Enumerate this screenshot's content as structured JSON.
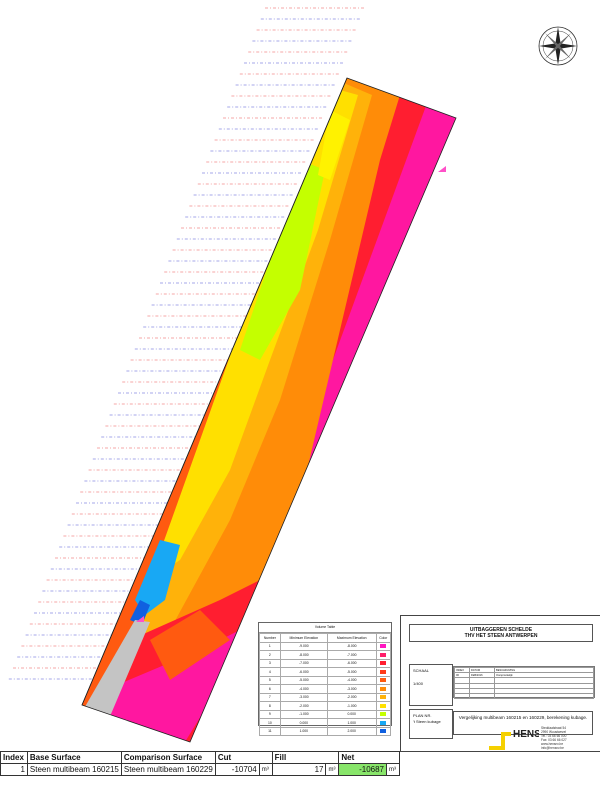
{
  "map": {
    "colors": {
      "magenta": "#ff17a0",
      "red": "#ff1e30",
      "orange_red": "#ff5a10",
      "orange": "#ff8c08",
      "amber": "#ffb20a",
      "yellow": "#fff200",
      "yellow_green": "#c4ff00",
      "cyan": "#18a8f4",
      "gray": "#c4c4c4",
      "label_red": "#f06060",
      "label_blue": "#5a60d8"
    }
  },
  "volume_table": {
    "title": "Volume Table",
    "headers": [
      "Number",
      "Minimum Elevation",
      "Maximum Elevation",
      "Color"
    ],
    "rows": [
      {
        "n": "1",
        "min": "-9.000",
        "max": "-8.000",
        "color": "#ff17c0"
      },
      {
        "n": "2",
        "min": "-8.000",
        "max": "-7.000",
        "color": "#ff1e6a"
      },
      {
        "n": "3",
        "min": "-7.000",
        "max": "-6.000",
        "color": "#ff1e30"
      },
      {
        "n": "4",
        "min": "-6.000",
        "max": "-5.000",
        "color": "#ff3a18"
      },
      {
        "n": "5",
        "min": "-5.000",
        "max": "-4.000",
        "color": "#ff5a10"
      },
      {
        "n": "6",
        "min": "-4.000",
        "max": "-3.000",
        "color": "#ff8c08"
      },
      {
        "n": "7",
        "min": "-3.000",
        "max": "-2.000",
        "color": "#ffb20a"
      },
      {
        "n": "8",
        "min": "-2.000",
        "max": "-1.000",
        "color": "#ffe000"
      },
      {
        "n": "9",
        "min": "-1.000",
        "max": "0.000",
        "color": "#c4ff00"
      },
      {
        "n": "10",
        "min": "0.000",
        "max": "1.000",
        "color": "#18a8f4"
      },
      {
        "n": "11",
        "min": "1.000",
        "max": "2.000",
        "color": "#1060e0"
      }
    ]
  },
  "title_block": {
    "title_line1": "UITBAGGEREN SCHELDE",
    "title_line2": "THV HET STEEN ANTWERPEN",
    "scale_label": "SCHAAL",
    "scale_value": "1/400",
    "rev_headers": [
      "INDEX",
      "DATUM",
      "BESCHRIJVING"
    ],
    "rev_row": [
      "00",
      "FEB/2016",
      "Oorspronkelijk"
    ],
    "plan_label": "PLAN NR.",
    "plan_value": "'t Steen kubage",
    "description": "Vergelijking multibeam 160215 en 160229, berekening kubage."
  },
  "company": {
    "name": "HENS",
    "address": [
      "Steddaalstraat 54",
      "2990 Wuustwezel",
      "Tel.: 03 66 66 000",
      "Fax: 03 66 66 027",
      "www.hensnv.be",
      "info@hensnv.be"
    ]
  },
  "results": {
    "headers": {
      "index": "Index",
      "base": "Base Surface",
      "comparison": "Comparison Surface",
      "cut": "Cut",
      "fill": "Fill",
      "net": "Net"
    },
    "row": {
      "index": "1",
      "base": "Steen multibeam 160215",
      "comparison": "Steen multibeam 160229",
      "cut": "-10704",
      "cut_unit": "m³",
      "fill": "17",
      "fill_unit": "m³",
      "net": "-10687",
      "net_unit": "m³"
    }
  }
}
